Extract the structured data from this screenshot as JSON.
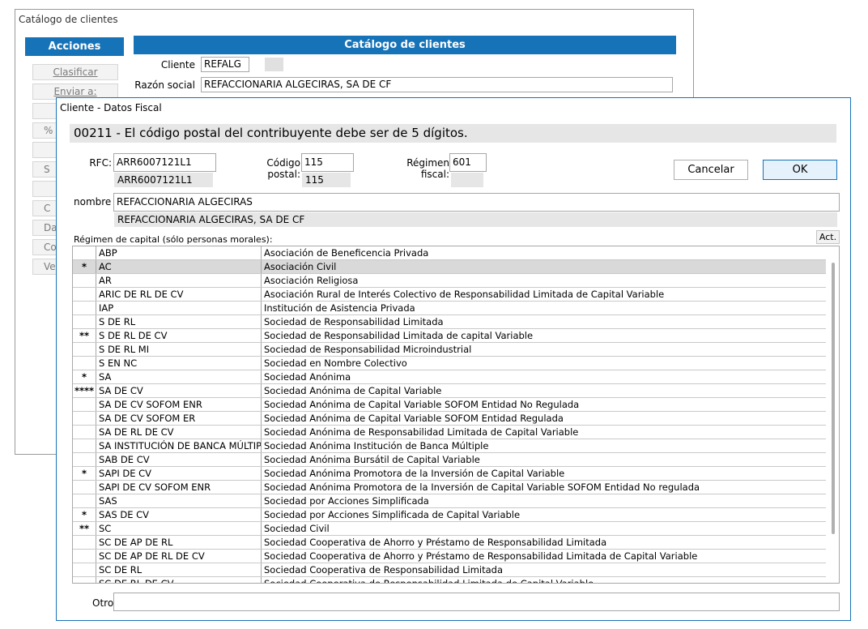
{
  "bg_window": {
    "title": "Catálogo de clientes",
    "acciones_header": "Acciones",
    "catalogo_header": "Catálogo de clientes",
    "side_buttons": [
      "Clasificar",
      "Enviar a:",
      "",
      "%",
      "",
      "S",
      "",
      "C",
      "Da",
      "Co",
      "Ve"
    ],
    "cliente_label": "Cliente",
    "cliente_value": "REFALG",
    "razon_label": "Razón social",
    "razon_value": "REFACCIONARIA ALGECIRAS, SA DE CF"
  },
  "dialog": {
    "title": "Cliente - Datos Fiscal",
    "error_message": "00211 - El código postal del contribuyente debe ser de 5 dígitos.",
    "rfc_label": "RFC:",
    "rfc_value": "ARR6007121L1",
    "rfc_echo": "ARR6007121L1",
    "cp_label": "Código postal:",
    "cp_value": "115",
    "cp_echo": "115",
    "regimen_label": "Régimen fiscal:",
    "regimen_value": "601",
    "regimen_echo": "",
    "cancel_label": "Cancelar",
    "ok_label": "OK",
    "nombre_label": "nombre",
    "nombre_value": "REFACCIONARIA ALGECIRAS",
    "nombre_echo": "REFACCIONARIA ALGECIRAS, SA DE CF",
    "capital_label": "Régimen de capital (sólo personas morales):",
    "act_label": "Act.",
    "otro_label": "Otro:",
    "otro_value": ""
  },
  "regimen_rows": [
    {
      "mark": "",
      "code": "ABP",
      "desc": "Asociación de Beneficencia Privada"
    },
    {
      "mark": "*",
      "code": "AC",
      "desc": "Asociación Civil",
      "selected": true
    },
    {
      "mark": "",
      "code": "AR",
      "desc": "Asociación Religiosa"
    },
    {
      "mark": "",
      "code": "ARIC DE RL DE CV",
      "desc": "Asociación Rural de Interés Colectivo de Responsabilidad Limitada de Capital Variable"
    },
    {
      "mark": "",
      "code": "IAP",
      "desc": "Institución de Asistencia Privada"
    },
    {
      "mark": "",
      "code": "S DE RL",
      "desc": "Sociedad de Responsabilidad Limitada"
    },
    {
      "mark": "**",
      "code": "S DE RL DE CV",
      "desc": "Sociedad de Responsabilidad Limitada de capital Variable"
    },
    {
      "mark": "",
      "code": "S DE RL MI",
      "desc": "Sociedad de Responsabilidad Microindustrial"
    },
    {
      "mark": "",
      "code": "S EN NC",
      "desc": "Sociedad en Nombre Colectivo"
    },
    {
      "mark": "*",
      "code": "SA",
      "desc": "Sociedad Anónima"
    },
    {
      "mark": "****",
      "code": "SA DE CV",
      "desc": "Sociedad Anónima de Capital Variable"
    },
    {
      "mark": "",
      "code": "SA DE CV SOFOM ENR",
      "desc": "Sociedad Anónima de Capital Variable SOFOM Entidad No Regulada"
    },
    {
      "mark": "",
      "code": "SA DE CV SOFOM ER",
      "desc": "Sociedad Anónima de Capital Variable SOFOM Entidad Regulada"
    },
    {
      "mark": "",
      "code": "SA DE RL DE CV",
      "desc": "Sociedad Anónima de Responsabilidad Limitada de Capital Variable"
    },
    {
      "mark": "",
      "code": "SA INSTITUCIÓN DE BANCA MÚLTIPLE",
      "desc": "Sociedad Anónima Institución de Banca Múltiple"
    },
    {
      "mark": "",
      "code": "SAB DE CV",
      "desc": "Sociedad Anónima Bursátil de Capital Variable"
    },
    {
      "mark": "*",
      "code": "SAPI DE CV",
      "desc": "Sociedad Anónima Promotora de la Inversión de Capital Variable"
    },
    {
      "mark": "",
      "code": "SAPI DE CV SOFOM ENR",
      "desc": "Sociedad Anónima Promotora de la Inversión de Capital Variable SOFOM Entidad No regulada"
    },
    {
      "mark": "",
      "code": "SAS",
      "desc": "Sociedad por Acciones Simplificada"
    },
    {
      "mark": "*",
      "code": "SAS DE CV",
      "desc": "Sociedad por Acciones Simplificada de Capital Variable"
    },
    {
      "mark": "**",
      "code": "SC",
      "desc": "Sociedad Civil"
    },
    {
      "mark": "",
      "code": "SC DE AP DE RL",
      "desc": "Sociedad Cooperativa de Ahorro y Préstamo de Responsabilidad Limitada"
    },
    {
      "mark": "",
      "code": "SC DE AP DE RL DE CV",
      "desc": "Sociedad Cooperativa de Ahorro y Préstamo de Responsabilidad Limitada de Capital Variable"
    },
    {
      "mark": "",
      "code": "SC DE RL",
      "desc": "Sociedad Cooperativa de Responsabilidad Limitada"
    },
    {
      "mark": "",
      "code": "SC DE RL DE CV",
      "desc": "Sociedad Cooperativa de Responsabilidad Limitada de Capital Variable"
    }
  ]
}
